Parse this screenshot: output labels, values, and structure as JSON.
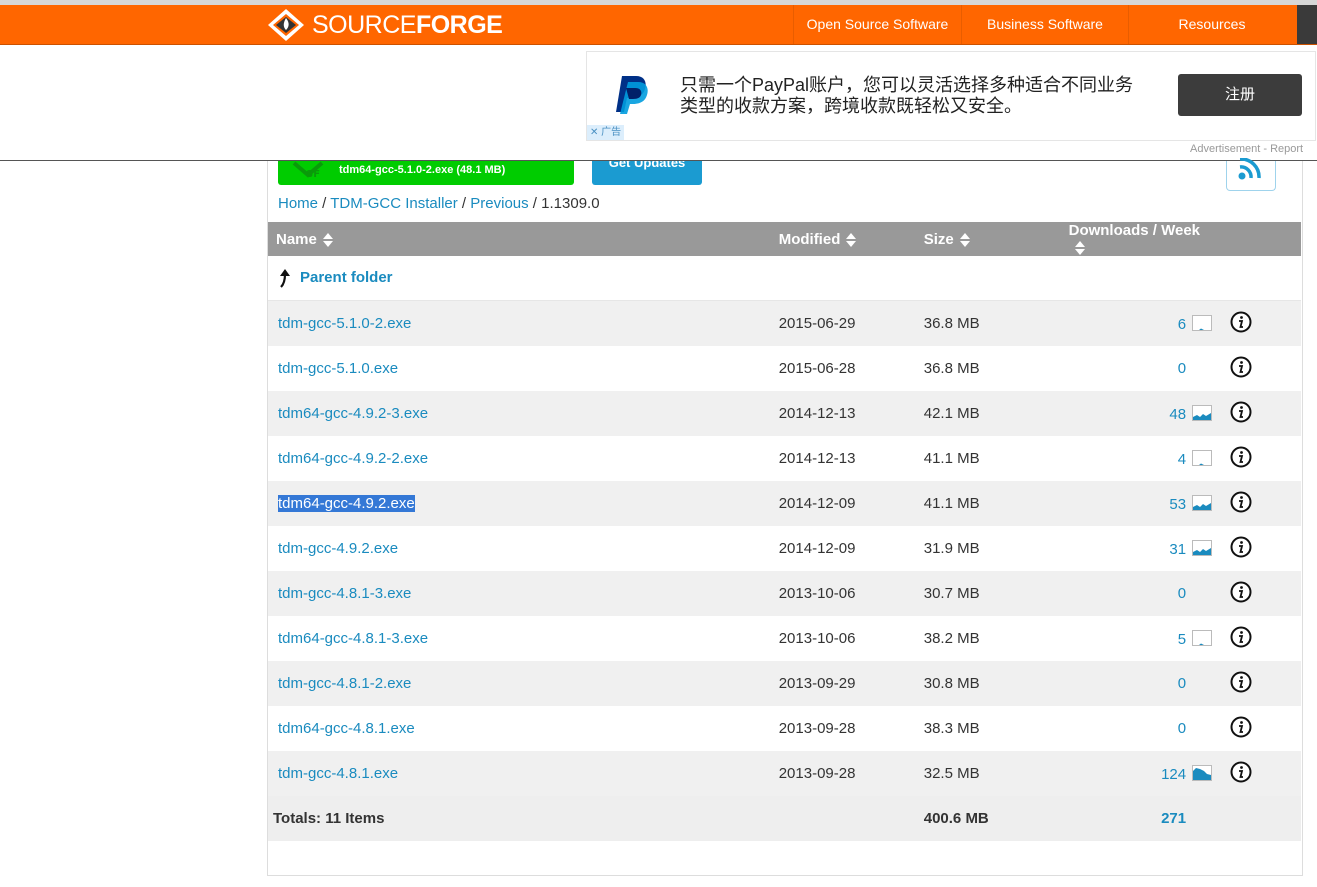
{
  "header": {
    "logo_text_light": "SOURCE",
    "logo_text_bold": "FORGE",
    "nav": [
      "Open Source Software",
      "Business Software",
      "Resources"
    ],
    "brand_color": "#ff6600"
  },
  "ad": {
    "text": "只需一个PayPal账户，您可以灵活选择多种适合不同业务类型的收款方案，跨境收款既轻松又安全。",
    "button": "注册",
    "choice_label": "广告",
    "report": "Advertisement - Report"
  },
  "download_button": "tdm64-gcc-5.1.0-2.exe (48.1 MB)",
  "updates_button": "Get Updates",
  "breadcrumb": {
    "home": "Home",
    "project": "TDM-GCC Installer",
    "previous": "Previous",
    "current": "1.1309.0"
  },
  "table": {
    "headers": {
      "name": "Name",
      "modified": "Modified",
      "size": "Size",
      "downloads": "Downloads / Week"
    },
    "parent_label": "Parent folder",
    "rows": [
      {
        "name": "tdm-gcc-5.1.0-2.exe",
        "modified": "2015-06-29",
        "size": "36.8 MB",
        "downloads": "6",
        "spark": "low"
      },
      {
        "name": "tdm-gcc-5.1.0.exe",
        "modified": "2015-06-28",
        "size": "36.8 MB",
        "downloads": "0",
        "spark": "none"
      },
      {
        "name": "tdm64-gcc-4.9.2-3.exe",
        "modified": "2014-12-13",
        "size": "42.1 MB",
        "downloads": "48",
        "spark": "mid"
      },
      {
        "name": "tdm64-gcc-4.9.2-2.exe",
        "modified": "2014-12-13",
        "size": "41.1 MB",
        "downloads": "4",
        "spark": "low"
      },
      {
        "name": "tdm64-gcc-4.9.2.exe",
        "modified": "2014-12-09",
        "size": "41.1 MB",
        "downloads": "53",
        "spark": "mid",
        "selected": true
      },
      {
        "name": "tdm-gcc-4.9.2.exe",
        "modified": "2014-12-09",
        "size": "31.9 MB",
        "downloads": "31",
        "spark": "mid"
      },
      {
        "name": "tdm-gcc-4.8.1-3.exe",
        "modified": "2013-10-06",
        "size": "30.7 MB",
        "downloads": "0",
        "spark": "none"
      },
      {
        "name": "tdm64-gcc-4.8.1-3.exe",
        "modified": "2013-10-06",
        "size": "38.2 MB",
        "downloads": "5",
        "spark": "low"
      },
      {
        "name": "tdm-gcc-4.8.1-2.exe",
        "modified": "2013-09-29",
        "size": "30.8 MB",
        "downloads": "0",
        "spark": "none"
      },
      {
        "name": "tdm64-gcc-4.8.1.exe",
        "modified": "2013-09-28",
        "size": "38.3 MB",
        "downloads": "0",
        "spark": "none"
      },
      {
        "name": "tdm-gcc-4.8.1.exe",
        "modified": "2013-09-28",
        "size": "32.5 MB",
        "downloads": "124",
        "spark": "high"
      }
    ],
    "totals": {
      "label": "Totals: 11 Items",
      "size": "400.6 MB",
      "downloads": "271"
    }
  },
  "colors": {
    "link": "#1a8bbf",
    "download_green": "#00cc00",
    "update_blue": "#1b9bd1",
    "header_gray": "#999999"
  }
}
